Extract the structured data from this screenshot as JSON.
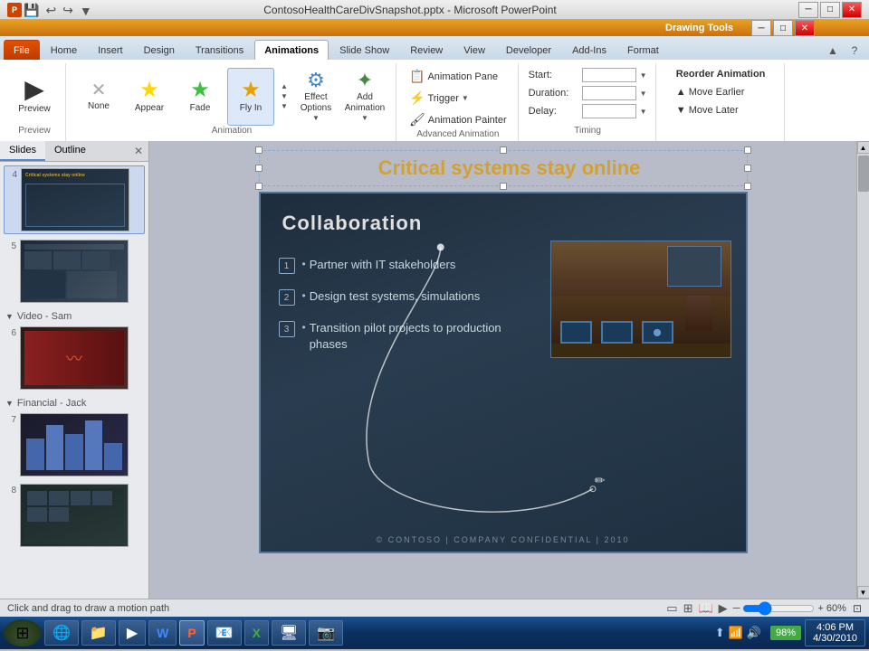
{
  "titlebar": {
    "title": "ContosoHealthCareDivSnapshot.pptx - Microsoft PowerPoint",
    "drawing_tools": "Drawing Tools",
    "ppt_label": "P"
  },
  "ribbon": {
    "tabs": [
      "File",
      "Home",
      "Insert",
      "Design",
      "Transitions",
      "Animations",
      "Slide Show",
      "Review",
      "View",
      "Developer",
      "Add-Ins",
      "Format"
    ],
    "active_tab": "Animations",
    "groups": {
      "preview": {
        "label": "Preview",
        "btn": "Preview"
      },
      "animation": {
        "label": "Animation",
        "items": [
          "None",
          "Appear",
          "Fade",
          "Fly In"
        ],
        "effect_options": "Effect Options",
        "add_animation": "Add Animation"
      },
      "advanced_animation": {
        "label": "Advanced Animation",
        "animation_pane": "Animation Pane",
        "trigger": "Trigger",
        "animation_painter": "Animation Painter"
      },
      "timing": {
        "label": "Timing",
        "start_label": "Start:",
        "duration_label": "Duration:",
        "delay_label": "Delay:"
      },
      "reorder": {
        "label": "Reorder Animation",
        "move_earlier": "Move Earlier",
        "move_later": "Move Later"
      }
    }
  },
  "slides_panel": {
    "tabs": [
      "Slides",
      "Outline"
    ],
    "active_tab": "Slides",
    "sections": [
      {
        "label": "Video - Sam",
        "expanded": true,
        "icon": "▼"
      },
      {
        "label": "Financial - Jack",
        "expanded": true,
        "icon": "▼"
      }
    ],
    "slides": [
      {
        "num": "4",
        "section": null
      },
      {
        "num": "5",
        "section": null
      },
      {
        "num": "6",
        "section": "Video - Sam"
      },
      {
        "num": "7",
        "section": "Financial - Jack"
      },
      {
        "num": "8",
        "section": null
      }
    ]
  },
  "slide": {
    "title": "Critical systems stay online",
    "content": {
      "heading": "Collaboration",
      "bullets": [
        {
          "num": "1",
          "text": "Partner with IT stakeholders"
        },
        {
          "num": "2",
          "text": "Design test systems, simulations"
        },
        {
          "num": "3",
          "text": "Transition pilot projects to production phases"
        }
      ],
      "footer": "© CONTOSO  |  COMPANY CONFIDENTIAL  |  2010"
    }
  },
  "status_bar": {
    "message": "Click and drag to draw a motion path",
    "zoom": "60%"
  },
  "taskbar": {
    "apps": [
      {
        "icon": "🌐",
        "label": ""
      },
      {
        "icon": "📁",
        "label": ""
      },
      {
        "icon": "▶",
        "label": ""
      },
      {
        "icon": "W",
        "label": ""
      },
      {
        "icon": "P",
        "label": ""
      },
      {
        "icon": "📧",
        "label": ""
      },
      {
        "icon": "📗",
        "label": ""
      },
      {
        "icon": "🖥",
        "label": ""
      },
      {
        "icon": "📷",
        "label": ""
      }
    ],
    "clock": "4:06 PM\n4/30/2010",
    "battery": "98%"
  }
}
